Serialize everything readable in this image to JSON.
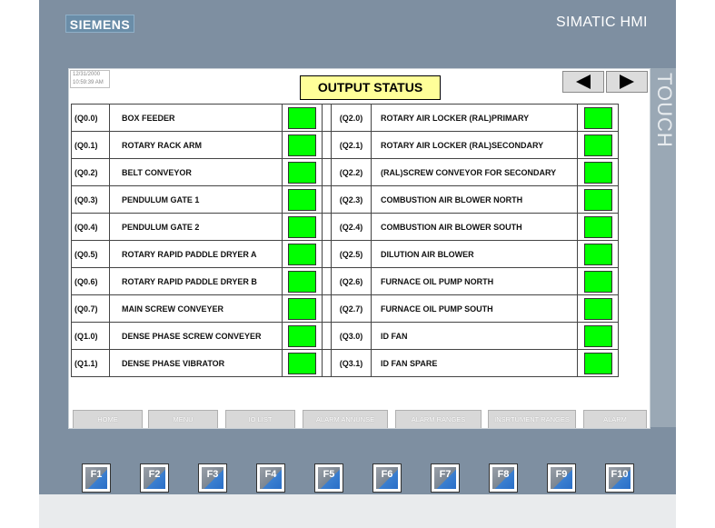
{
  "panel": {
    "brand": "SIEMENS",
    "model": "SIMATIC HMI",
    "touch_label": "TOUCH"
  },
  "screen": {
    "clock_date": "12/31/2000",
    "clock_time": "10:59:39 AM",
    "title": "OUTPUT STATUS"
  },
  "rows": [
    {
      "addr1": "(Q0.0)",
      "name1": "BOX FEEDER",
      "addr2": "(Q2.0)",
      "name2": "ROTARY AIR LOCKER (RAL)PRIMARY"
    },
    {
      "addr1": "(Q0.1)",
      "name1": "ROTARY RACK ARM",
      "addr2": "(Q2.1)",
      "name2": "ROTARY AIR LOCKER (RAL)SECONDARY"
    },
    {
      "addr1": "(Q0.2)",
      "name1": "BELT CONVEYOR",
      "addr2": "(Q2.2)",
      "name2": "(RAL)SCREW CONVEYOR FOR SECONDARY"
    },
    {
      "addr1": "(Q0.3)",
      "name1": "PENDULUM GATE 1",
      "addr2": "(Q2.3)",
      "name2": "COMBUSTION AIR BLOWER NORTH"
    },
    {
      "addr1": "(Q0.4)",
      "name1": "PENDULUM GATE 2",
      "addr2": "(Q2.4)",
      "name2": "COMBUSTION AIR BLOWER SOUTH"
    },
    {
      "addr1": "(Q0.5)",
      "name1": "ROTARY RAPID PADDLE DRYER A",
      "addr2": "(Q2.5)",
      "name2": "DILUTION AIR BLOWER"
    },
    {
      "addr1": "(Q0.6)",
      "name1": "ROTARY RAPID PADDLE DRYER B",
      "addr2": "(Q2.6)",
      "name2": "FURNACE OIL PUMP NORTH"
    },
    {
      "addr1": "(Q0.7)",
      "name1": "MAIN SCREW CONVEYER",
      "addr2": "(Q2.7)",
      "name2": "FURNACE OIL PUMP SOUTH"
    },
    {
      "addr1": "(Q1.0)",
      "name1": "DENSE PHASE SCREW CONVEYER",
      "addr2": "(Q3.0)",
      "name2": "ID FAN"
    },
    {
      "addr1": "(Q1.1)",
      "name1": "DENSE PHASE VIBRATOR",
      "addr2": "(Q3.1)",
      "name2": "ID FAN SPARE"
    }
  ],
  "status_color": "#00ff00",
  "softkeys": [
    "HOME",
    "MENU",
    "IO LIST",
    "ALARM ANNUNSE",
    "ALARM RANGES",
    "INSRTUMENT RANGES",
    "ALARM"
  ],
  "fkeys": [
    "F1",
    "F2",
    "F3",
    "F4",
    "F5",
    "F6",
    "F7",
    "F8",
    "F9",
    "F10"
  ]
}
